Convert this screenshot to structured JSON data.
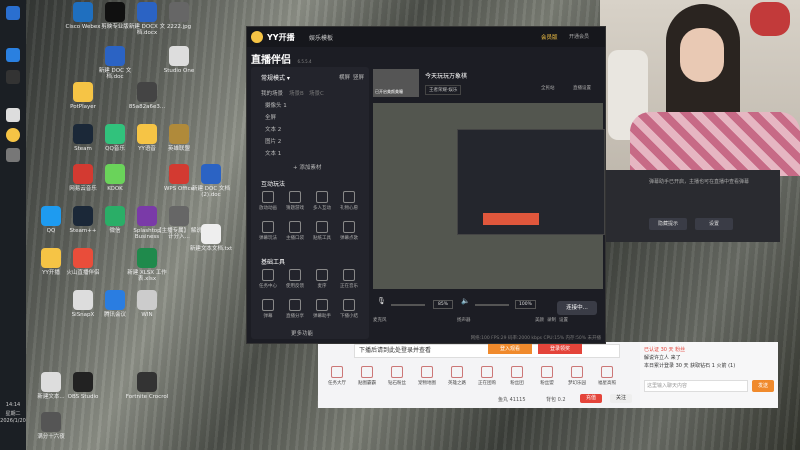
{
  "desktop_icons": [
    {
      "label": "Cisco Webex",
      "color": "#1f6fbf"
    },
    {
      "label": "剪映专业版",
      "color": "#101010"
    },
    {
      "label": "新建 DOCX 文档.docx",
      "color": "#2b63c4"
    },
    {
      "label": "2222.jpg",
      "color": "#666"
    },
    {
      "label": "新建 DOC 文档.doc",
      "color": "#2b63c4"
    },
    {
      "label": "Studio One",
      "color": "#ddd"
    },
    {
      "label": "PotPlayer",
      "color": "#f6c445"
    },
    {
      "label": "85a82a6e3...",
      "color": "#444"
    },
    {
      "label": "Steam",
      "color": "#1b2838"
    },
    {
      "label": "QQ音乐",
      "color": "#31c27c"
    },
    {
      "label": "YY语音",
      "color": "#f6c445"
    },
    {
      "label": "英雄联盟",
      "color": "#b08a3a"
    },
    {
      "label": "网易云音乐",
      "color": "#d33a31"
    },
    {
      "label": "KOOK",
      "color": "#6ad35a"
    },
    {
      "label": "WPS Office",
      "color": "#d33a31"
    },
    {
      "label": "新建 DOC 文档 (2).doc",
      "color": "#2b63c4"
    },
    {
      "label": "QQ",
      "color": "#1e9bf0"
    },
    {
      "label": "Steam++",
      "color": "#1b2838"
    },
    {
      "label": "微信",
      "color": "#2aae67"
    },
    {
      "label": "Splashtop Business",
      "color": "#7a3aa8"
    },
    {
      "label": "【主播专属】 解说计分入...",
      "color": "#666"
    },
    {
      "label": "新建文本文档.txt",
      "color": "#eee"
    },
    {
      "label": "YY开播",
      "color": "#f6c445"
    },
    {
      "label": "火山直播伴侣",
      "color": "#e94d3a"
    },
    {
      "label": "新建 XLSX 工作表.xlsx",
      "color": "#1f8a4c"
    },
    {
      "label": "SiSnapX",
      "color": "#ddd"
    },
    {
      "label": "腾讯会议",
      "color": "#2a7de1"
    },
    {
      "label": "WIN",
      "color": "#ccc"
    },
    {
      "label": "新建文本...",
      "color": "#ddd"
    },
    {
      "label": "OBS Studio",
      "color": "#222"
    },
    {
      "label": "Fortnite Crocrol",
      "color": "#333"
    },
    {
      "label": "满分十六夜",
      "color": "#555"
    }
  ],
  "taskbar": {
    "time": "14:14",
    "weekday": "星期二",
    "date": "2026/1/20"
  },
  "yy": {
    "title": "YY开播",
    "tab": "娱乐模板",
    "vip": "会员版",
    "start": "开通会员",
    "app_name": "直播伴侣",
    "version": "6.5.5.4",
    "mode": "常规模式",
    "landscape": "横屏",
    "portrait": "竖屏",
    "my_scenes": "我的场景",
    "scene_b": "场景B",
    "scene_c": "场景C",
    "sources": [
      "摄像头 1",
      "全屏",
      "文本 2",
      "图片 2",
      "文本 1"
    ],
    "add_source": "添加素材",
    "section_play": "互动玩法",
    "play_tools": [
      "放动动画",
      "猜题游戏",
      "多人互动",
      "礼物心愿",
      "弹幕玩法",
      "主播口袋",
      "贴纸工具",
      "弹幕点歌"
    ],
    "section_tools": "基础工具",
    "basic_tools": [
      "任务中心",
      "使用反馈",
      "麦序",
      "正在音乐",
      "弹幕",
      "直播分享",
      "弹幕助手",
      "下播小结"
    ],
    "more": "更多功能",
    "stream_title": "今天玩玩万象棋",
    "stream_sub": "已开启美颜美瞳",
    "category": "王者荣耀·娱乐",
    "btn_live": "全民站",
    "btn_setting": "直播设置",
    "mic_label": "麦克风",
    "mic_pct": "85%",
    "speaker_label": "扬声器",
    "speaker_pct": "100%",
    "beauty": "美颜",
    "record": "录制",
    "settings": "设置",
    "connect": "连接中...",
    "status": "网络:100 FPS:29 码率:2000 kbps CPU:15% 内存:50% 未开播"
  },
  "right_panel": {
    "text": "弹幕助手已开启，主播也可在直播中查看弹幕",
    "btn_hide": "隐藏提示",
    "btn_set": "设置"
  },
  "browser": {
    "banner": "下播后请到此处登录并查看",
    "btn1": "登入观看",
    "btn2": "登录领奖",
    "icons": [
      "任务大厅",
      "贴图霸霸",
      "钻石粉丝",
      "宠物地图",
      "英雄之路",
      "正在团购",
      "粉丝团",
      "粉丝盟",
      "梦幻乐园",
      "福星高照"
    ],
    "balance_label": "鱼丸 41115",
    "bag": "背包 0.2",
    "btn_recharge": "充值",
    "btn_follow": "关注"
  },
  "chat": {
    "messages": [
      "已认证 30 天 粉丝",
      "解说许立人 来了",
      "本日累计登录 30 天 获取钻石 1 火箭 (1)"
    ],
    "placeholder": "这里输入聊天内容",
    "send": "发送"
  }
}
